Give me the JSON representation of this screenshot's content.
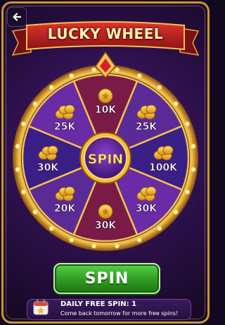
{
  "header": {
    "title": "LUCKY WHEEL",
    "back_icon": "back-arrow-icon"
  },
  "wheel": {
    "center_label": "SPIN",
    "segments": [
      {
        "id": "top",
        "label": "10K",
        "icon": "coin-icon",
        "color": "#7a1a46"
      },
      {
        "id": "top-right",
        "label": "25K",
        "icon": "coin-stack-icon",
        "color": "#5a2b96"
      },
      {
        "id": "right",
        "label": "100K",
        "icon": "coin-stack-icon",
        "color": "#3a1f87"
      },
      {
        "id": "bottom-right",
        "label": "30K",
        "icon": "coin-stack-icon",
        "color": "#6a2ba6"
      },
      {
        "id": "bottom",
        "label": "30K",
        "icon": "coin-icon",
        "color": "#7a1a46"
      },
      {
        "id": "bottom-left",
        "label": "20K",
        "icon": "coin-stack-icon",
        "color": "#5a2b96"
      },
      {
        "id": "left",
        "label": "30K",
        "icon": "coin-stack-icon",
        "color": "#3a1f87"
      },
      {
        "id": "top-left",
        "label": "25K",
        "icon": "coin-stack-icon",
        "color": "#6a2ba6"
      }
    ],
    "pointer_icon": "ruby-pointer-icon",
    "accent_gold": "#f2b636"
  },
  "spin_button": {
    "label": "SPIN",
    "color": "#3fb82f"
  },
  "daily": {
    "title": "DAILY FREE SPIN: 1",
    "subtitle": "Come back tomorrow for more free spins!",
    "icon": "calendar-icon"
  }
}
